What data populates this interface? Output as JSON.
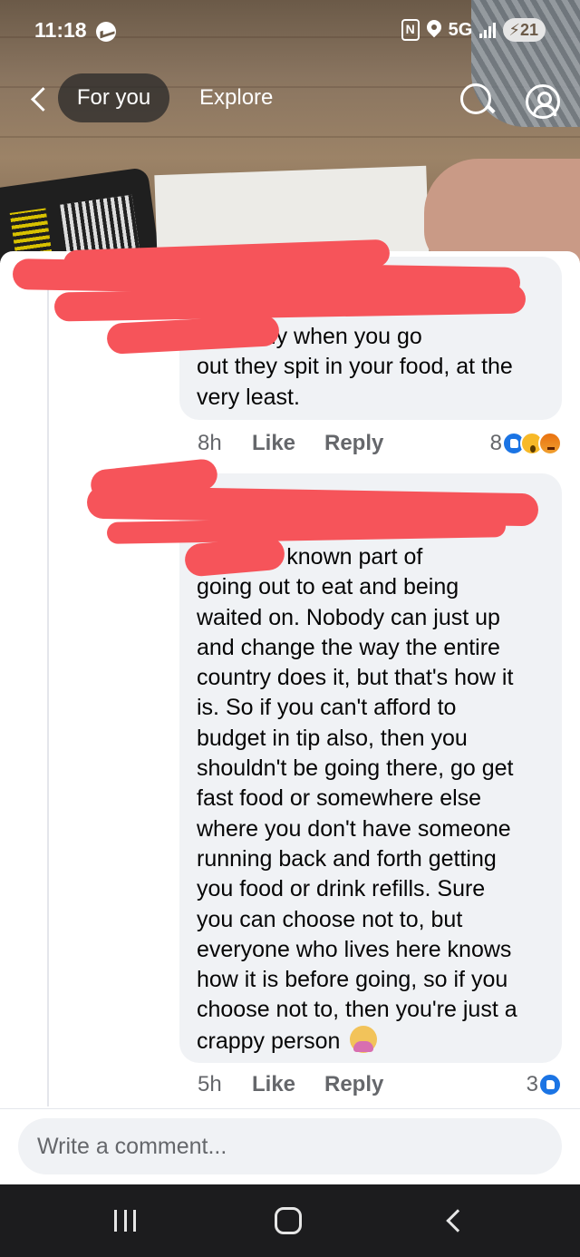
{
  "status_bar": {
    "time": "11:18",
    "network": "5G",
    "battery": "21",
    "icons": [
      "messenger-icon",
      "nfc-icon",
      "location-icon",
      "signal-icon",
      "battery-icon"
    ]
  },
  "nav": {
    "back_icon": "chevron-left-icon",
    "tabs": [
      {
        "label": "For you",
        "active": true
      },
      {
        "label": "Explore",
        "active": false
      }
    ],
    "search_icon": "search-icon",
    "profile_icon": "profile-icon"
  },
  "comments": [
    {
      "text": "hopefully when you go\nout they spit in your food, at the\nvery least.",
      "time": "8h",
      "like_label": "Like",
      "reply_label": "Reply",
      "reaction_count": "8",
      "reactions": [
        "like",
        "wow",
        "angry"
      ]
    },
    {
      "text": "no, it's a known part of\ngoing out to eat and being\nwaited on.  Nobody can just up\nand change the way the entire\ncountry does it, but that's how it\nis. So if you can't afford to\nbudget in tip also, then you\nshouldn't be going there, go get\nfast food or somewhere else\nwhere you don't have someone\nrunning back and forth getting\nyou food or drink refills. Sure\nyou can choose not to, but\neveryone who lives here knows\nhow it is before going, so if you\nchoose not to, then you're just a\ncrappy person",
      "emoji": "person-shrugging-emoji",
      "time": "5h",
      "like_label": "Like",
      "reply_label": "Reply",
      "reaction_count": "3",
      "reactions": [
        "like"
      ]
    }
  ],
  "composer": {
    "placeholder": "Write a comment..."
  },
  "colors": {
    "scribble": "#f6545a",
    "bubble": "#f0f2f5",
    "meta_text": "#65676b",
    "like_blue": "#1b74e4"
  }
}
